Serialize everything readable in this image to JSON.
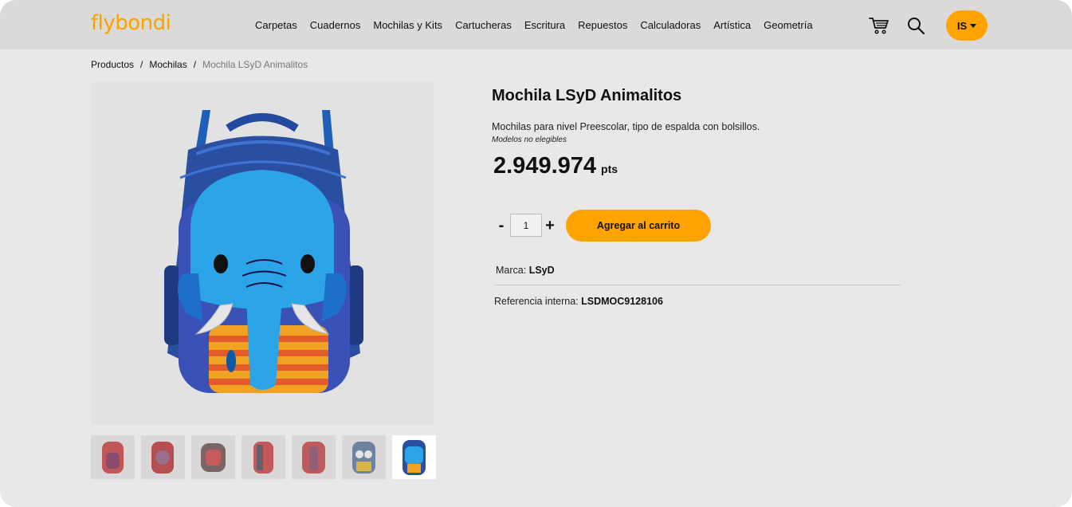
{
  "header": {
    "logo": "flybondi",
    "nav": [
      "Carpetas",
      "Cuadernos",
      "Mochilas y Kits",
      "Cartucheras",
      "Escritura",
      "Repuestos",
      "Calculadoras",
      "Artística",
      "Geometría"
    ],
    "cart_icon": "cart-icon",
    "search_icon": "search-icon",
    "user_initials": "IS"
  },
  "breadcrumb": {
    "items": [
      "Productos",
      "Mochilas"
    ],
    "current": "Mochila LSyD Animalitos",
    "separator": "/"
  },
  "product": {
    "title": "Mochila LSyD Animalitos",
    "description": "Mochilas para nivel Preescolar, tipo de espalda con bolsillos.",
    "note": "Modelos no elegibles",
    "price": "2.949.974",
    "price_unit": "pts",
    "quantity": "1",
    "qty_minus": "-",
    "qty_plus": "+",
    "add_to_cart": "Agregar al carrito",
    "brand_label": "Marca:",
    "brand": "LSyD",
    "ref_label": "Referencia interna:",
    "ref": "LSDMOC9128106"
  },
  "colors": {
    "accent": "#ffa300",
    "logo": "#f6a400",
    "background": "#e9e7e8",
    "header": "#dcdad9"
  }
}
